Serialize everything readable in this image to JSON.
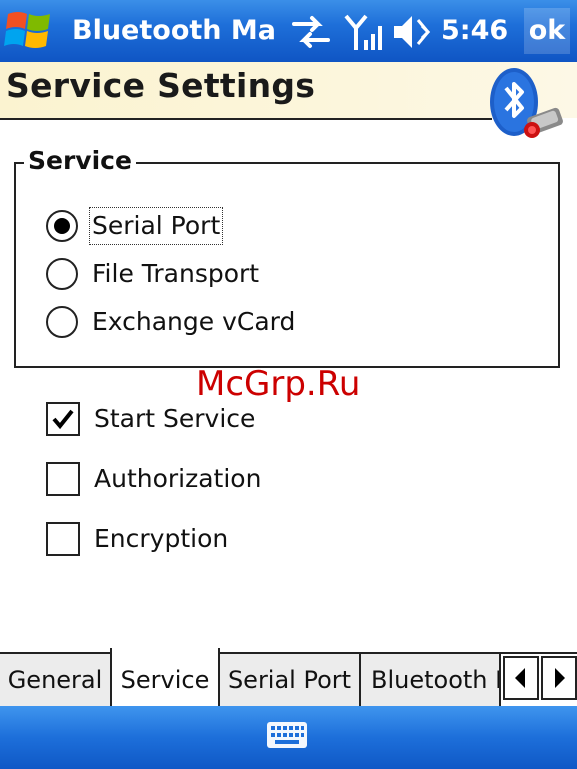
{
  "titlebar": {
    "app_title": "Bluetooth Manager",
    "clock": "5:46",
    "ok_label": "ok",
    "icons": [
      "start-icon",
      "sync-arrows-icon",
      "signal-icon",
      "volume-muted-icon"
    ]
  },
  "header": {
    "title": "Service Settings"
  },
  "service_group": {
    "legend": "Service",
    "options": [
      {
        "label": "Serial Port",
        "checked": true
      },
      {
        "label": "File Transport",
        "checked": false
      },
      {
        "label": "Exchange vCard",
        "checked": false
      }
    ]
  },
  "checkboxes": [
    {
      "label": "Start Service",
      "checked": true
    },
    {
      "label": "Authorization",
      "checked": false
    },
    {
      "label": "Encryption",
      "checked": false
    }
  ],
  "watermark": "McGrp.Ru",
  "tabs": [
    {
      "label": "General",
      "active": false
    },
    {
      "label": "Service",
      "active": true
    },
    {
      "label": "Serial Port",
      "active": false
    },
    {
      "label": "Bluetooth Headset",
      "active": false
    }
  ],
  "colors": {
    "titlebar": "#1e6fd9",
    "header_bg": "#fbf3d0",
    "watermark": "#cc0000"
  }
}
